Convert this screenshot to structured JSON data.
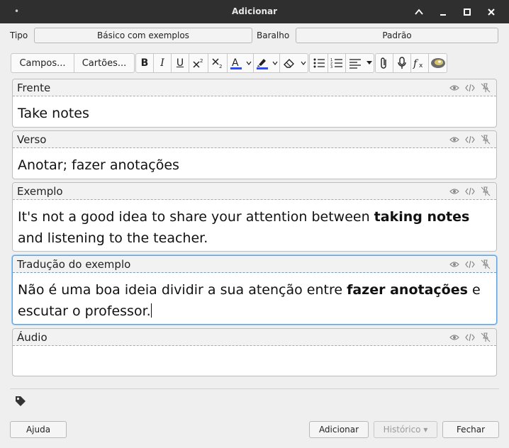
{
  "window": {
    "title": "Adicionar",
    "menu_dot": "•"
  },
  "top": {
    "type_label": "Tipo",
    "type_value": "Básico com exemplos",
    "deck_label": "Baralho",
    "deck_value": "Padrão"
  },
  "toolbar": {
    "fields_label": "Campos...",
    "cards_label": "Cartões...",
    "bold": "B",
    "italic": "I",
    "underline": "U",
    "text_color": "#2a4cff",
    "highlight_color": "#2a4cff"
  },
  "fields": [
    {
      "name": "Frente",
      "pre": "Take notes",
      "bold": "",
      "post": ""
    },
    {
      "name": "Verso",
      "pre": "Anotar; fazer anotações",
      "bold": "",
      "post": ""
    },
    {
      "name": "Exemplo",
      "pre": "It's not a good idea to share your attention between ",
      "bold": "taking notes",
      "post": " and listening to the teacher."
    },
    {
      "name": "Tradução do exemplo",
      "pre": "Não é uma boa ideia dividir a sua atenção entre ",
      "bold": "fazer anotações",
      "post": " e escutar o professor."
    },
    {
      "name": "Áudio",
      "pre": "",
      "bold": "",
      "post": ""
    }
  ],
  "buttons": {
    "help": "Ajuda",
    "add": "Adicionar",
    "history": "Histórico ▾",
    "close": "Fechar"
  },
  "colors": {
    "titlebar": "#2f2f2f",
    "focus": "#5aa3e6"
  }
}
